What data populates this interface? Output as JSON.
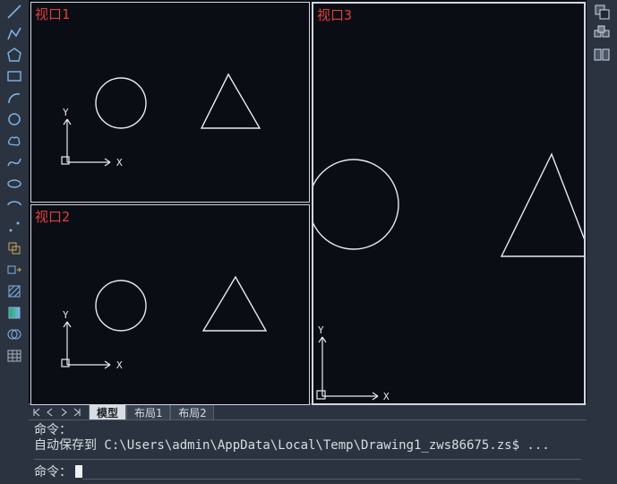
{
  "toolbar_left_icons": [
    "line-icon",
    "polyline-icon",
    "polygon-icon",
    "rectangle-icon",
    "arc-icon",
    "circle-icon",
    "revcloud-icon",
    "spline-icon",
    "ellipse-icon",
    "ellipse-arc-icon",
    "point-icon",
    "block-icon",
    "stretch-icon",
    "hatch-icon",
    "gradient-icon",
    "region-icon",
    "table-icon"
  ],
  "toolbar_right_icons": [
    "overlap-icon",
    "group-icon",
    "tile-icon"
  ],
  "viewports": {
    "vp1": {
      "label": "视口1"
    },
    "vp2": {
      "label": "视口2"
    },
    "vp3": {
      "label": "视口3"
    }
  },
  "tabs": {
    "model": "模型",
    "layout1": "布局1",
    "layout2": "布局2"
  },
  "command": {
    "line1": "命令：",
    "line2": "自动保存到 C:\\Users\\admin\\AppData\\Local\\Temp\\Drawing1_zws86675.zs$ ...",
    "prompt": "命令："
  },
  "winctl": {
    "min": "—",
    "max": "◻",
    "close": "✕"
  },
  "ucs": {
    "xLabel": "X",
    "yLabel": "Y"
  }
}
